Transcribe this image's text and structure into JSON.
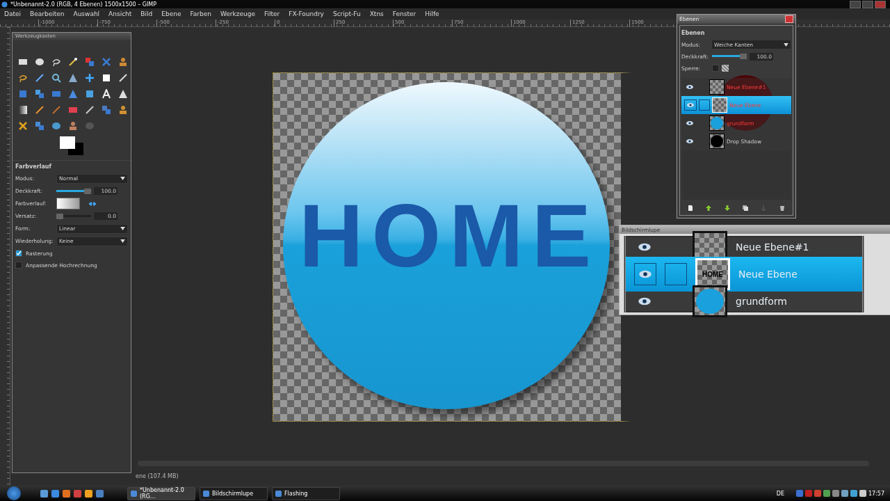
{
  "window": {
    "title": "*Unbenannt-2.0 (RGB, 4 Ebenen) 1500x1500 – GIMP"
  },
  "menu": [
    "Datei",
    "Bearbeiten",
    "Auswahl",
    "Ansicht",
    "Bild",
    "Ebene",
    "Farben",
    "Werkzeuge",
    "Filter",
    "FX-Foundry",
    "Script-Fu",
    "Xtns",
    "Fenster",
    "Hilfe"
  ],
  "ruler": {
    "labels": [
      "-1000",
      "-750",
      "-500",
      "-250",
      "0",
      "250",
      "500",
      "750",
      "1000",
      "1250",
      "1500"
    ]
  },
  "toolbox": {
    "title": "Werkzeugkasten"
  },
  "tool_options": {
    "title": "Farbverlauf",
    "fields": [
      {
        "kind": "dropdown",
        "label": "Modus:",
        "value": "Normal"
      },
      {
        "kind": "slider",
        "label": "Deckkraft:",
        "value": "100.0",
        "level": 1
      },
      {
        "kind": "gradient",
        "label": "Farbverlauf:"
      },
      {
        "kind": "slider",
        "label": "Versatz:",
        "value": "0.0",
        "level": 0
      },
      {
        "kind": "dropdown",
        "label": "Form:",
        "value": "Linear"
      },
      {
        "kind": "dropdown",
        "label": "Wiederholung:",
        "value": "Keine"
      }
    ],
    "checkboxes": [
      {
        "label": "Rasterung",
        "checked": true
      },
      {
        "label": "Anpassende Hochrechnung",
        "checked": false
      }
    ]
  },
  "canvas": {
    "logo_text": "HOME"
  },
  "status_bar": {
    "text": "ene (107.4 MB)"
  },
  "layers_dialog": {
    "title": "Ebenen",
    "heading": "Ebenen",
    "mode_label": "Modus:",
    "mode": "Weiche Kanten",
    "opacity_label": "Deckkraft:",
    "opacity": "100.0",
    "level": 1,
    "lock_label": "Sperre:",
    "lock_checked": false,
    "layers": [
      {
        "name": "Neue Ebene#1",
        "visible": true,
        "selected": false,
        "thumbnail": {
          "kind": "checker"
        }
      },
      {
        "name": "Neue Ebene",
        "visible": true,
        "selected": true,
        "thumbnail": {
          "kind": "text"
        }
      },
      {
        "name": "grundform",
        "visible": true,
        "selected": false,
        "thumbnail": {
          "kind": "circle"
        }
      },
      {
        "name": "Drop Shadow",
        "visible": true,
        "selected": false,
        "thumbnail": {
          "kind": "shadow"
        }
      }
    ]
  },
  "magnifier": {
    "title": "Bildschirmlupe",
    "rows": [
      {
        "name": "Neue Ebene#1",
        "selected": false,
        "thumbnail": {
          "kind": "checker"
        }
      },
      {
        "name": "Neue Ebene",
        "selected": true,
        "thumbnail": {
          "kind": "text",
          "text": "HOME"
        }
      },
      {
        "name": "grundform",
        "selected": false,
        "thumbnail": {
          "kind": "circle"
        }
      }
    ]
  },
  "taskbar": {
    "tasks": [
      {
        "label": "*Unbenannt-2.0 (RG...",
        "selected": true
      },
      {
        "label": "Bildschirmlupe",
        "selected": false
      },
      {
        "label": "Flashing",
        "selected": false
      }
    ],
    "language": "DE",
    "clock": "17:57"
  }
}
